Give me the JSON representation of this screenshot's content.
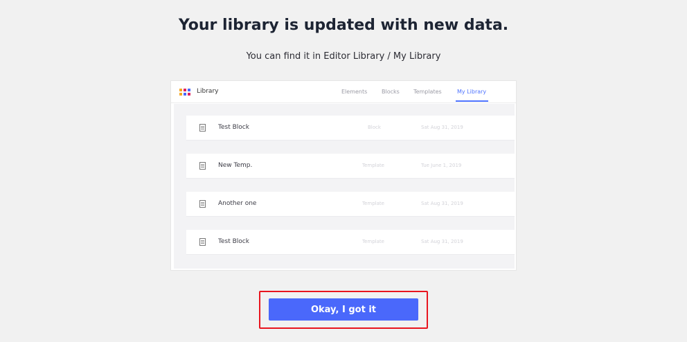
{
  "dialog": {
    "title": "Your library is updated with new data.",
    "subtitle": "You can find it in Editor Library / My Library",
    "confirm_label": "Okay, I got it"
  },
  "preview": {
    "logo_text": "Library",
    "logo_colors": [
      "#f5a623",
      "#e0245e",
      "#4a68fb",
      "#f5a623",
      "#4a68fb",
      "#e0245e"
    ],
    "tabs": [
      {
        "label": "Elements",
        "active": false
      },
      {
        "label": "Blocks",
        "active": false
      },
      {
        "label": "Templates",
        "active": false
      },
      {
        "label": "My Library",
        "active": true
      }
    ],
    "items": [
      {
        "name": "Test Block",
        "type": "Block",
        "date": "Sat Aug 31, 2019"
      },
      {
        "name": "New Temp.",
        "type": "Template",
        "date": "Tue June 1, 2019"
      },
      {
        "name": "Another one",
        "type": "Template",
        "date": "Sat Aug 31, 2019"
      },
      {
        "name": "Test Block",
        "type": "Template",
        "date": "Sat Aug 31, 2019"
      }
    ]
  },
  "colors": {
    "accent": "#4a68fb",
    "highlight_border": "#e8141e",
    "background": "#f1f1f1"
  }
}
